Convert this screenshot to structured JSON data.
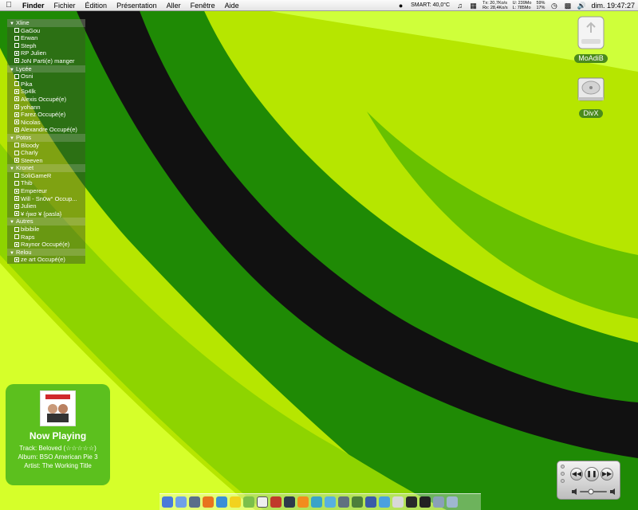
{
  "menubar": {
    "apple_icon": "apple-icon",
    "menus": [
      "Finder",
      "Fichier",
      "Édition",
      "Présentation",
      "Aller",
      "Fenêtre",
      "Aide"
    ],
    "smart": "SMART: 40,0°C",
    "net_tx": "Tx: 20,7Ko/s",
    "net_rx": "Rx: 28,4Ko/s",
    "mem_u": "U: 239Mo",
    "mem_l": "L: 785Mo",
    "cpu_1": "59%",
    "cpu_2": "17%",
    "clock": "dim. 19:47:27"
  },
  "buddylist": {
    "groups": [
      {
        "name": "Xline",
        "buddies": [
          {
            "name": "GaGou",
            "online": false
          },
          {
            "name": "Erwan",
            "online": false
          },
          {
            "name": "Steph",
            "online": false
          },
          {
            "name": "RP Julien",
            "online": true
          },
          {
            "name": "JoN Parti(e) manger",
            "online": true
          }
        ]
      },
      {
        "name": "Lycée",
        "buddies": [
          {
            "name": "Osni",
            "online": false
          },
          {
            "name": "Pika",
            "online": false
          },
          {
            "name": "Sp4lk",
            "online": true
          },
          {
            "name": "Alexis Occupé(e)",
            "online": true
          },
          {
            "name": "yohann",
            "online": true
          },
          {
            "name": "Farez Occupé(e)",
            "online": true
          },
          {
            "name": "Nicolas",
            "online": true
          },
          {
            "name": "Alexandre Occupé(e)",
            "online": true
          }
        ]
      },
      {
        "name": "Potos",
        "buddies": [
          {
            "name": "Bloody",
            "online": false
          },
          {
            "name": "Charly",
            "online": false
          },
          {
            "name": "Steeven",
            "online": true
          }
        ]
      },
      {
        "name": "Kronet",
        "buddies": [
          {
            "name": "SoliGameR",
            "online": false
          },
          {
            "name": "Thib",
            "online": false
          },
          {
            "name": "Empereur",
            "online": true
          },
          {
            "name": "Will - Sn0w° Occup...",
            "online": true
          },
          {
            "name": "Julien",
            "online": true
          },
          {
            "name": "¥ ήιкσ ¥ {pasla}",
            "online": true
          }
        ]
      },
      {
        "name": "Autres",
        "buddies": [
          {
            "name": "bibibile",
            "online": false
          },
          {
            "name": "Raps",
            "online": false
          },
          {
            "name": "Raynor Occupé(e)",
            "online": true
          }
        ]
      },
      {
        "name": "Relou",
        "buddies": [
          {
            "name": "ze art Occupé(e)",
            "online": true
          }
        ]
      }
    ]
  },
  "desktop": {
    "disks": [
      {
        "label": "MoAdiB",
        "icon": "external-drive-icon"
      },
      {
        "label": "DivX",
        "icon": "hard-drive-icon"
      }
    ]
  },
  "nowplaying": {
    "title": "Now Playing",
    "track": "Track: Beloved (☆☆☆☆☆)",
    "album": "Album: BSO American Pie 3",
    "artist": "Artist: The Working Title"
  },
  "itunes_controller": {
    "prev_icon": "rewind-icon",
    "play_icon": "pause-icon",
    "next_icon": "fast-forward-icon"
  },
  "dock": {
    "items": [
      "finder-icon",
      "mail-icon",
      "globe-icon",
      "firefox-icon",
      "safari-icon",
      "duck-icon",
      "adium-icon",
      "x11-icon",
      "snowman-icon",
      "cube-icon",
      "vlc-icon",
      "media-icon",
      "itunes-icon",
      "screen-icon",
      "iphoto-icon",
      "imovie-icon",
      "app-icon",
      "window-icon",
      "film-icon",
      "terminal-icon",
      "prefs-icon",
      "trash-icon"
    ]
  },
  "colors": {
    "wallpaper_dark_green": "#1e7d06",
    "wallpaper_lime": "#c6f000",
    "widget_green": "#5cc01e"
  }
}
